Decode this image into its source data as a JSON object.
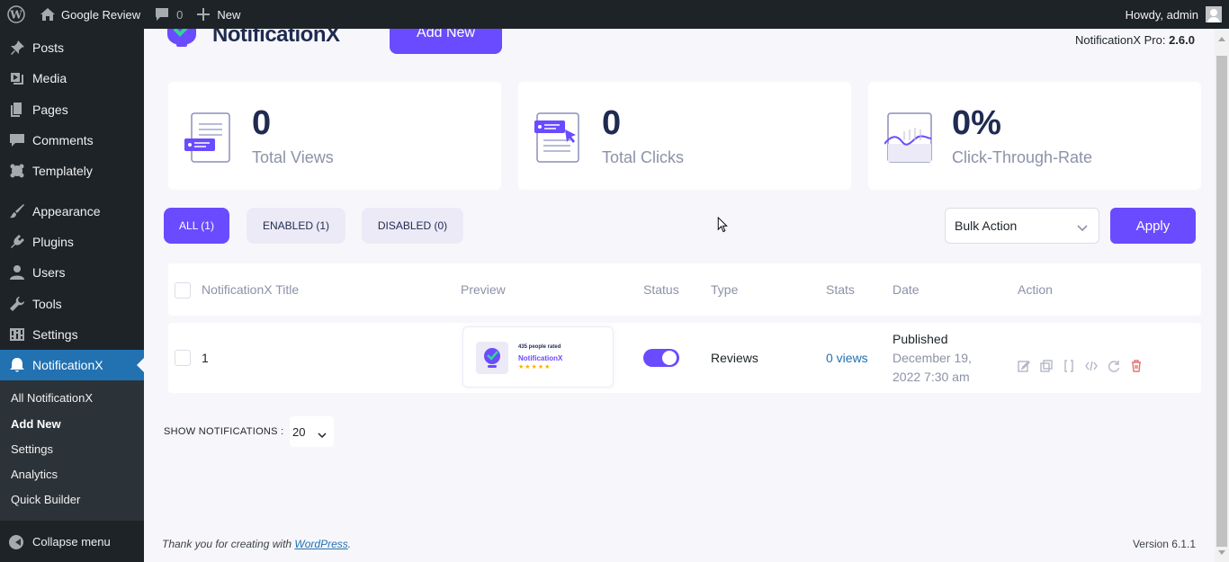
{
  "adminbar": {
    "site_name": "Google Review",
    "comments_count": "0",
    "new_label": "New",
    "howdy": "Howdy, admin"
  },
  "sidebar": {
    "items": [
      {
        "label": "Posts",
        "icon": "pin-icon"
      },
      {
        "label": "Media",
        "icon": "media-icon"
      },
      {
        "label": "Pages",
        "icon": "pages-icon"
      },
      {
        "label": "Comments",
        "icon": "comment-icon"
      },
      {
        "label": "Templately",
        "icon": "templately-icon"
      },
      {
        "label": "Appearance",
        "icon": "brush-icon"
      },
      {
        "label": "Plugins",
        "icon": "plugin-icon"
      },
      {
        "label": "Users",
        "icon": "user-icon"
      },
      {
        "label": "Tools",
        "icon": "wrench-icon"
      },
      {
        "label": "Settings",
        "icon": "settings-icon"
      },
      {
        "label": "NotificationX",
        "icon": "notificationx-icon"
      }
    ],
    "submenu": [
      "All NotificationX",
      "Add New",
      "Settings",
      "Analytics",
      "Quick Builder"
    ],
    "collapse_label": "Collapse menu"
  },
  "header": {
    "logo_text": "NotificationX",
    "add_new_label": "Add New",
    "version_label": "NotificationX Pro:",
    "version_value": "2.6.0"
  },
  "stats": [
    {
      "value": "0",
      "label": "Total Views"
    },
    {
      "value": "0",
      "label": "Total Clicks"
    },
    {
      "value": "0%",
      "label": "Click-Through-Rate"
    }
  ],
  "filters": [
    {
      "label": "ALL (1)",
      "active": true
    },
    {
      "label": "ENABLED (1)",
      "active": false
    },
    {
      "label": "DISABLED (0)",
      "active": false
    }
  ],
  "bulk_action": {
    "selected": "Bulk Action",
    "apply_label": "Apply"
  },
  "table": {
    "columns": [
      "NotificationX Title",
      "Preview",
      "Status",
      "Type",
      "Stats",
      "Date",
      "Action"
    ],
    "rows": [
      {
        "title": "1",
        "preview_line1": "435 people rated",
        "preview_line2": "NotificationX",
        "preview_stars": "★★★★★",
        "status_enabled": true,
        "type": "Reviews",
        "stats": "0 views",
        "date_status": "Published",
        "date_line1": "December 19,",
        "date_line2": "2022 7:30 am"
      }
    ]
  },
  "show_notifications": {
    "label": "SHOW NOTIFICATIONS :",
    "value": "20"
  },
  "footer": {
    "thanks_prefix": "Thank you for creating with ",
    "thanks_link": "WordPress",
    "thanks_suffix": ".",
    "version": "Version 6.1.1"
  },
  "colors": {
    "accent": "#6a4bff",
    "sidebar_bg": "#1d2327",
    "current_menu": "#2271b1"
  }
}
